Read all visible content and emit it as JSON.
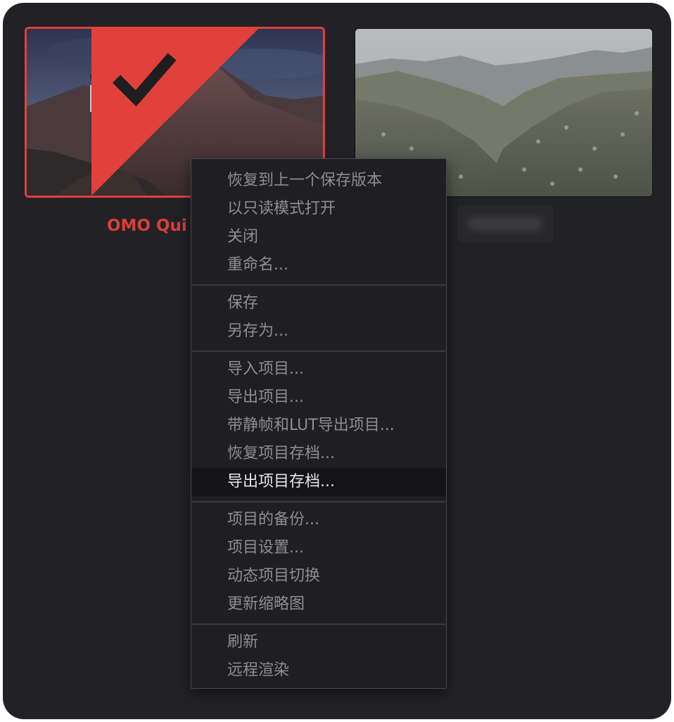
{
  "projects": [
    {
      "name": "OMO Qui",
      "selected": true
    },
    {
      "name": "",
      "selected": false
    }
  ],
  "context_menu": {
    "groups": [
      [
        "恢复到上一个保存版本",
        "以只读模式打开",
        "关闭",
        "重命名..."
      ],
      [
        "保存",
        "另存为..."
      ],
      [
        "导入项目...",
        "导出项目...",
        "带静帧和LUT导出项目...",
        "恢复项目存档...",
        "导出项目存档..."
      ],
      [
        "项目的备份...",
        "项目设置...",
        "动态项目切换",
        "更新缩略图"
      ],
      [
        "刷新",
        "远程渲染"
      ]
    ],
    "highlighted_item": "导出项目存档..."
  },
  "colors": {
    "panel_bg": "#222226",
    "selection_accent": "#e2403a",
    "menu_bg": "#1f1f22",
    "menu_text": "#8e8e92",
    "menu_text_highlight": "#e6e6e8"
  },
  "icons": [
    "checkmark-icon"
  ]
}
